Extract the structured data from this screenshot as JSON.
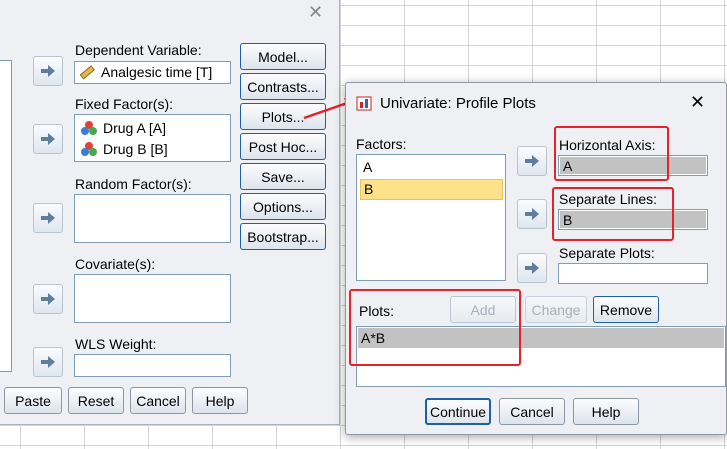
{
  "main_dialog": {
    "labels": {
      "dependent_variable": "Dependent Variable:",
      "fixed_factors": "Fixed Factor(s):",
      "random_factors": "Random Factor(s):",
      "covariates": "Covariate(s):",
      "wls_weight": "WLS Weight:"
    },
    "dependent_value": "Analgesic time [T]",
    "fixed_factor_items": [
      "Drug A [A]",
      "Drug B [B]"
    ],
    "side_buttons": [
      "Model...",
      "Contrasts...",
      "Plots...",
      "Post Hoc...",
      "Save...",
      "Options...",
      "Bootstrap..."
    ],
    "bottom_buttons": [
      "Paste",
      "Reset",
      "Cancel",
      "Help"
    ]
  },
  "profile_dialog": {
    "title": "Univariate: Profile Plots",
    "factors_label": "Factors:",
    "factors": [
      "A",
      "B"
    ],
    "selected_factor": "B",
    "horizontal_axis_label": "Horizontal Axis:",
    "horizontal_axis_value": "A",
    "separate_lines_label": "Separate Lines:",
    "separate_lines_value": "B",
    "separate_plots_label": "Separate Plots:",
    "separate_plots_value": "",
    "plots_label": "Plots:",
    "plot_buttons": {
      "add": "Add",
      "change": "Change",
      "remove": "Remove"
    },
    "plots_items": [
      "A*B"
    ],
    "bottom_buttons": {
      "continue": "Continue",
      "cancel": "Cancel",
      "help": "Help"
    }
  },
  "colors": {
    "highlight_red": "#e8212b",
    "selected_yellow": "#fde28a",
    "dialog_bg": "#eef0f3"
  }
}
